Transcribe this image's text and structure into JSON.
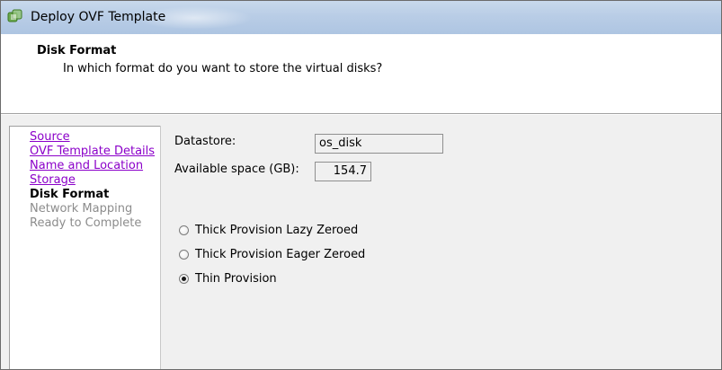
{
  "window": {
    "title": "Deploy OVF Template",
    "icon": "vsphere-logo-icon"
  },
  "header": {
    "title": "Disk Format",
    "subtitle": "In which format do you want to store the virtual disks?"
  },
  "steps": [
    {
      "label": "Source",
      "state": "link"
    },
    {
      "label": "OVF Template Details",
      "state": "link"
    },
    {
      "label": "Name and Location",
      "state": "link"
    },
    {
      "label": "Storage",
      "state": "link"
    },
    {
      "label": "Disk Format",
      "state": "current"
    },
    {
      "label": "Network Mapping",
      "state": "pending"
    },
    {
      "label": "Ready to Complete",
      "state": "pending"
    }
  ],
  "form": {
    "datastore_label": "Datastore:",
    "datastore_value": "os_disk",
    "available_label": "Available space (GB):",
    "available_value": "154.7"
  },
  "options": [
    {
      "label": "Thick Provision Lazy Zeroed",
      "selected": false
    },
    {
      "label": "Thick Provision Eager Zeroed",
      "selected": false
    },
    {
      "label": "Thin Provision",
      "selected": true
    }
  ],
  "colors": {
    "link": "#8b00c9",
    "pending": "#8c8c8c",
    "titlebar": "#b9cde6"
  }
}
